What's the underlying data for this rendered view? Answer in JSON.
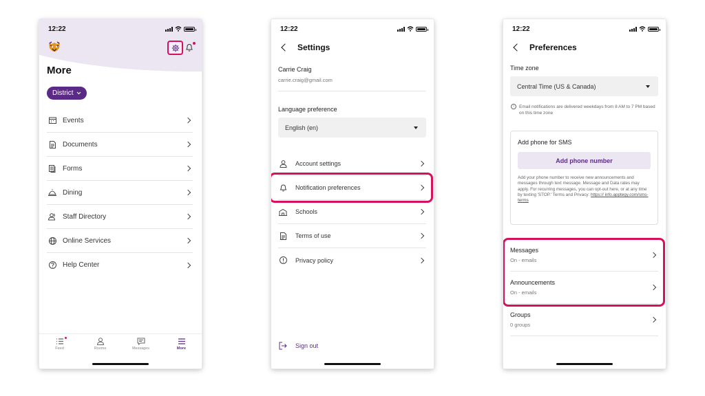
{
  "phone1": {
    "status_time": "12:22",
    "title": "More",
    "district_label": "District",
    "menu": [
      {
        "label": "Events",
        "icon": "calendar-icon"
      },
      {
        "label": "Documents",
        "icon": "document-icon"
      },
      {
        "label": "Forms",
        "icon": "forms-icon"
      },
      {
        "label": "Dining",
        "icon": "dining-icon"
      },
      {
        "label": "Staff Directory",
        "icon": "people-icon"
      },
      {
        "label": "Online Services",
        "icon": "globe-icon"
      },
      {
        "label": "Help Center",
        "icon": "help-icon"
      }
    ],
    "tabs": [
      {
        "label": "Feed",
        "icon": "feed-icon"
      },
      {
        "label": "Rooms",
        "icon": "rooms-icon"
      },
      {
        "label": "Messages",
        "icon": "messages-icon"
      },
      {
        "label": "More",
        "icon": "hamburger-icon"
      }
    ]
  },
  "phone2": {
    "status_time": "12:22",
    "title": "Settings",
    "user_name": "Carrie Craig",
    "user_email": "carrie.craig@gmail.com",
    "language_label": "Language preference",
    "language_value": "English (en)",
    "items": [
      {
        "label": "Account settings",
        "icon": "person-icon"
      },
      {
        "label": "Notification preferences",
        "icon": "bell-icon"
      },
      {
        "label": "Schools",
        "icon": "school-icon"
      },
      {
        "label": "Terms of use",
        "icon": "document-icon"
      },
      {
        "label": "Privacy policy",
        "icon": "info-icon"
      }
    ],
    "sign_out": "Sign out"
  },
  "phone3": {
    "status_time": "12:22",
    "title": "Preferences",
    "timezone_label": "Time zone",
    "timezone_value": "Central Time (US & Canada)",
    "timezone_note": "Email notifications are delivered weekdays from 8 AM to 7 PM based on this time zone",
    "sms_title": "Add phone for SMS",
    "sms_button": "Add phone number",
    "sms_desc": "Add your phone number to receive new announcements and messages through text message. Message and Data rates may apply. For recurring messages, you can opt-out here, or at any time by texting 'STOP.' Terms and Privacy:",
    "sms_link": "https:// info.apptegy.com/sms-terms",
    "prefs": [
      {
        "title": "Messages",
        "sub": "On - emails"
      },
      {
        "title": "Announcements",
        "sub": "On - emails"
      },
      {
        "title": "Groups",
        "sub": "0 groups"
      }
    ]
  },
  "colors": {
    "accent": "#5b2a86",
    "highlight": "#d7105d"
  }
}
